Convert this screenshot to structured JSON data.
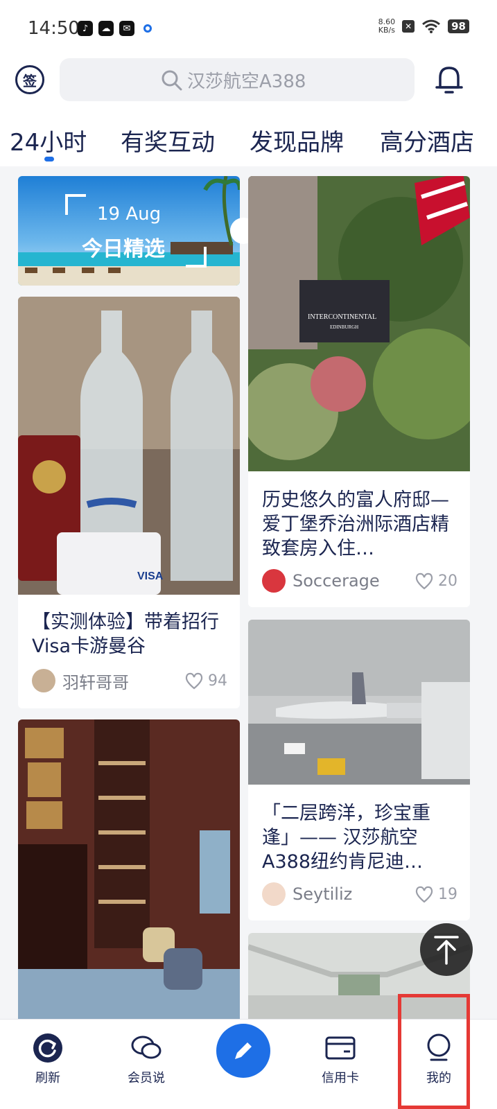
{
  "status_bar": {
    "time": "14:50",
    "net_speed_value": "8.60",
    "net_speed_unit": "KB/s",
    "battery": "98",
    "icons": [
      "tiktok-icon",
      "cloud-icon",
      "mail-icon",
      "blue-circle-icon",
      "close-box-icon",
      "wifi-icon",
      "battery-icon"
    ]
  },
  "header": {
    "logo_text": "签",
    "search_placeholder": "汉莎航空A388"
  },
  "tabs": [
    {
      "label": "24小时",
      "active": true
    },
    {
      "label": "有奖互动"
    },
    {
      "label": "发现品牌"
    },
    {
      "label": "高分酒店"
    }
  ],
  "feed": {
    "daily_pick": {
      "date": "19 Aug",
      "title": "今日精选"
    },
    "left": [
      {
        "title": "【实测体验】带着招行Visa卡游曼谷",
        "author": "羽轩哥哥",
        "likes": "94",
        "image": "bottles-passport-card-photo"
      },
      {
        "title": "",
        "image": "hotel-library-interior-photo"
      }
    ],
    "right": [
      {
        "title": "历史悠久的富人府邸—爱丁堡乔治洲际酒店精致套房入住…",
        "author": "Soccerage",
        "likes": "20",
        "image": "intercontinental-edinburgh-sign-photo"
      },
      {
        "title": "「二层跨洋，珍宝重逢」—— 汉莎航空A388纽约肯尼迪…",
        "author": "Seytiliz",
        "likes": "19",
        "image": "a380-at-gate-photo"
      },
      {
        "title": "",
        "image": "aircraft-cabin-photo"
      }
    ]
  },
  "bottom_nav": [
    {
      "label": "刷新",
      "icon": "refresh-icon"
    },
    {
      "label": "会员说",
      "icon": "chat-icon"
    },
    {
      "label": "",
      "icon": "pencil-icon"
    },
    {
      "label": "信用卡",
      "icon": "card-icon"
    },
    {
      "label": "我的",
      "icon": "profile-icon"
    }
  ],
  "colors": {
    "accent": "#1e6fe6",
    "navy": "#1b2550",
    "highlight": "#e53935"
  }
}
